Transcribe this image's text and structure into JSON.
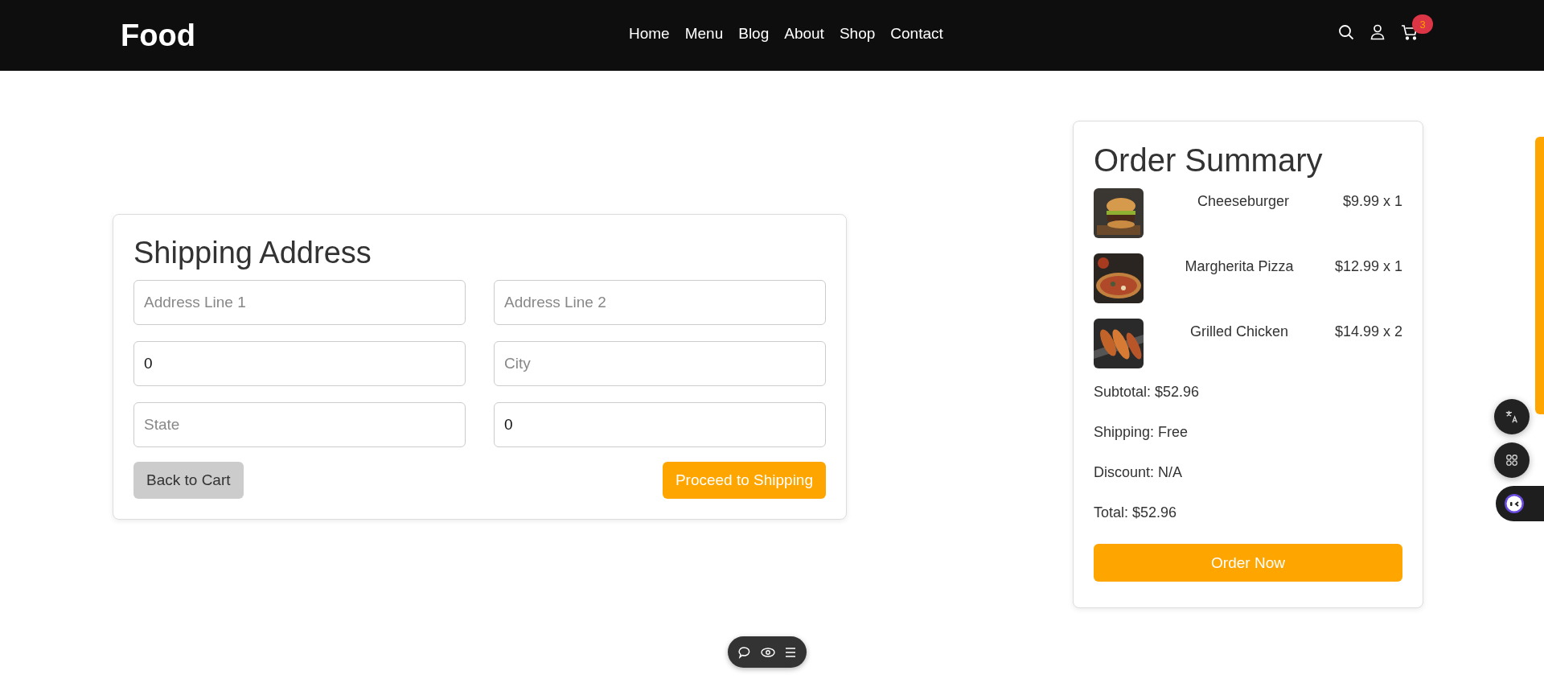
{
  "header": {
    "logo": "Food",
    "nav": [
      {
        "label": "Home"
      },
      {
        "label": "Menu"
      },
      {
        "label": "Blog"
      },
      {
        "label": "About"
      },
      {
        "label": "Shop"
      },
      {
        "label": "Contact"
      }
    ],
    "cart_count": "3"
  },
  "shipping": {
    "title": "Shipping Address",
    "fields": [
      {
        "placeholder": "Address Line 1"
      },
      {
        "placeholder": "Address Line 2"
      },
      {
        "value": "0"
      },
      {
        "placeholder": "City"
      },
      {
        "placeholder": "State"
      },
      {
        "value": "0"
      }
    ],
    "back_button": "Back to Cart",
    "proceed_button": "Proceed to Shipping"
  },
  "summary": {
    "title": "Order Summary",
    "items": [
      {
        "name": "Cheeseburger",
        "price": "$9.99 x 1"
      },
      {
        "name": "Margherita Pizza",
        "price": "$12.99 x 1"
      },
      {
        "name": "Grilled Chicken",
        "price": "$14.99 x 2"
      }
    ],
    "lines": [
      "Subtotal: $52.96",
      "Shipping: Free",
      "Discount: N/A",
      "Total: $52.96"
    ],
    "order_button": "Order Now"
  }
}
